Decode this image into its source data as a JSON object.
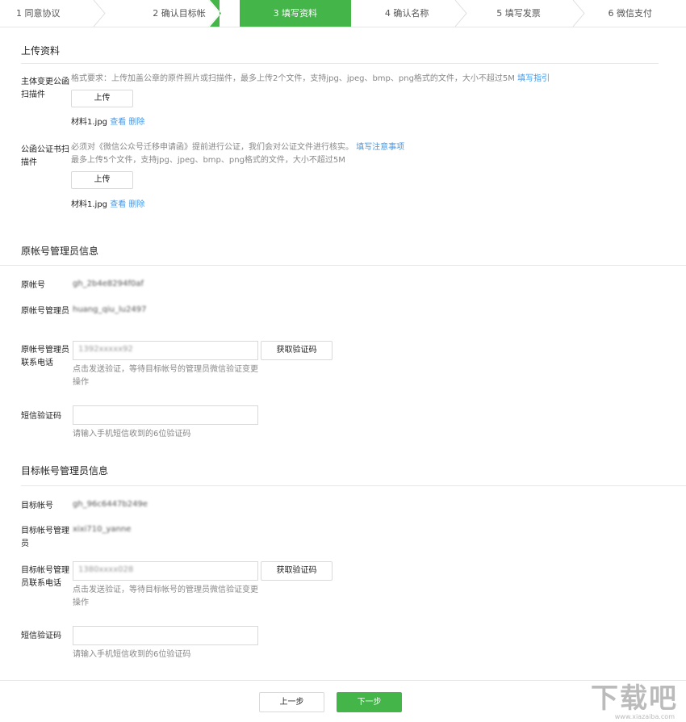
{
  "steps": [
    {
      "label": "1 同意协议",
      "state": "done"
    },
    {
      "label": "2 确认目标帐号",
      "state": "done"
    },
    {
      "label": "3 填写资料",
      "state": "active"
    },
    {
      "label": "4 确认名称",
      "state": "todo"
    },
    {
      "label": "5 填写发票",
      "state": "todo"
    },
    {
      "label": "6 微信支付",
      "state": "todo"
    }
  ],
  "upload": {
    "title": "上传资料",
    "change_letter": {
      "label": "主体变更公函扫描件",
      "requirement": "格式要求：上传加盖公章的原件照片或扫描件，最多上传2个文件，支持jpg、jpeg、bmp、png格式的文件，大小不超过5M",
      "guide_link": "填写指引",
      "upload_button": "上传",
      "file_name": "材料1.jpg",
      "view_link": "查看",
      "delete_link": "删除"
    },
    "notary": {
      "label": "公函公证书扫描件",
      "requirement_1": "必须对《微信公众号迁移申请函》提前进行公证，我们会对公证文件进行核实。",
      "notice_link": "填写注意事项",
      "requirement_2": "最多上传5个文件，支持jpg、jpeg、bmp、png格式的文件，大小不超过5M",
      "upload_button": "上传",
      "file_name": "材料1.jpg",
      "view_link": "查看",
      "delete_link": "删除"
    }
  },
  "origin": {
    "title": "原帐号管理员信息",
    "account_label": "原帐号",
    "account_value": "gh_2b4e8294f0af",
    "admin_label": "原帐号管理员",
    "admin_value": "huang_qiu_lu2497",
    "phone_label": "原帐号管理员联系电话",
    "phone_value": "1392xxxxx92",
    "get_code_button": "获取验证码",
    "phone_hint": "点击发送验证，等待目标帐号的管理员微信验证变更操作",
    "sms_label": "短信验证码",
    "sms_hint": "请输入手机短信收到的6位验证码"
  },
  "target": {
    "title": "目标帐号管理员信息",
    "account_label": "目标帐号",
    "account_value": "gh_96c6447b249e",
    "admin_label": "目标帐号管理员",
    "admin_value": "xixi710_yanne",
    "phone_label": "目标帐号管理员联系电话",
    "phone_value": "1380xxxx028",
    "get_code_button": "获取验证码",
    "phone_hint": "点击发送验证，等待目标帐号的管理员微信验证变更操作",
    "sms_label": "短信验证码",
    "sms_hint": "请输入手机短信收到的6位验证码"
  },
  "footer": {
    "prev_button": "上一步",
    "next_button": "下一步"
  },
  "watermark": {
    "text": "下载吧",
    "url": "www.xiazaiba.com"
  },
  "colors": {
    "accent": "#44b549",
    "link": "#459ae9"
  }
}
